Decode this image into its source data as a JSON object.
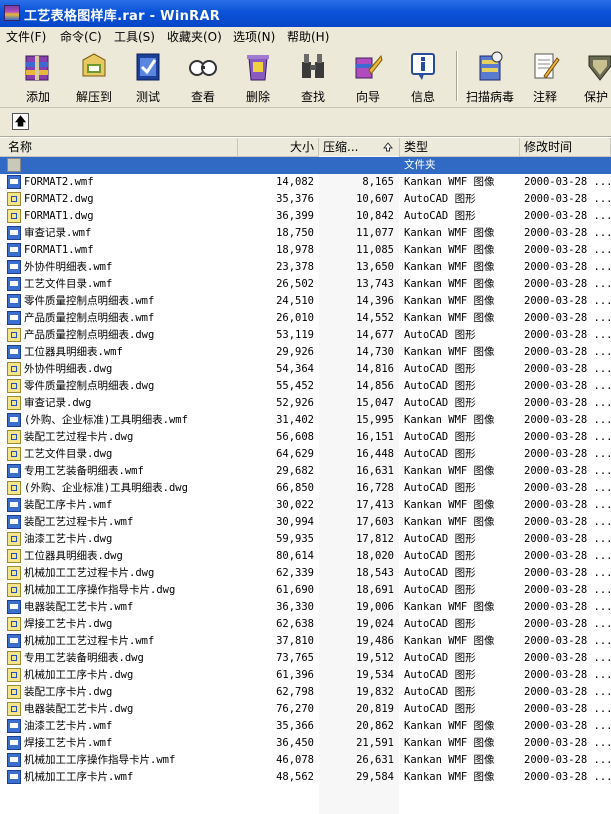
{
  "window": {
    "title": "工艺表格图样库.rar - WinRAR"
  },
  "menu": [
    "文件(F)",
    "命令(C)",
    "工具(S)",
    "收藏夹(O)",
    "选项(N)",
    "帮助(H)"
  ],
  "toolbar": [
    {
      "label": "添加",
      "icon": "add-icon"
    },
    {
      "label": "解压到",
      "icon": "extract-icon"
    },
    {
      "label": "测试",
      "icon": "test-icon"
    },
    {
      "label": "查看",
      "icon": "view-icon"
    },
    {
      "label": "删除",
      "icon": "delete-icon"
    },
    {
      "label": "查找",
      "icon": "find-icon"
    },
    {
      "label": "向导",
      "icon": "wizard-icon"
    },
    {
      "label": "信息",
      "icon": "info-icon"
    },
    {
      "label": "扫描病毒",
      "icon": "virus-scan-icon"
    },
    {
      "label": "注释",
      "icon": "comment-icon"
    },
    {
      "label": "保护",
      "icon": "protect-icon"
    }
  ],
  "address": {
    "up_icon": "up-folder-icon",
    "up_glyph": "🡅"
  },
  "columns": {
    "name": "名称",
    "size": "大小",
    "packed": "压缩...",
    "type": "类型",
    "modified": "修改时间"
  },
  "parent_row": {
    "type": "文件夹"
  },
  "files": [
    {
      "name": "FORMAT2.wmf",
      "size": "14,082",
      "packed": "8,165",
      "type": "Kankan WMF 图像",
      "date": "2000-03-28 ...",
      "kind": "wmf"
    },
    {
      "name": "FORMAT2.dwg",
      "size": "35,376",
      "packed": "10,607",
      "type": "AutoCAD 图形",
      "date": "2000-03-28 ...",
      "kind": "dwg"
    },
    {
      "name": "FORMAT1.dwg",
      "size": "36,399",
      "packed": "10,842",
      "type": "AutoCAD 图形",
      "date": "2000-03-28 ...",
      "kind": "dwg"
    },
    {
      "name": "审查记录.wmf",
      "size": "18,750",
      "packed": "11,077",
      "type": "Kankan WMF 图像",
      "date": "2000-03-28 ...",
      "kind": "wmf"
    },
    {
      "name": "FORMAT1.wmf",
      "size": "18,978",
      "packed": "11,085",
      "type": "Kankan WMF 图像",
      "date": "2000-03-28 ...",
      "kind": "wmf"
    },
    {
      "name": "外协件明细表.wmf",
      "size": "23,378",
      "packed": "13,650",
      "type": "Kankan WMF 图像",
      "date": "2000-03-28 ...",
      "kind": "wmf"
    },
    {
      "name": "工艺文件目录.wmf",
      "size": "26,502",
      "packed": "13,743",
      "type": "Kankan WMF 图像",
      "date": "2000-03-28 ...",
      "kind": "wmf"
    },
    {
      "name": "零件质量控制点明细表.wmf",
      "size": "24,510",
      "packed": "14,396",
      "type": "Kankan WMF 图像",
      "date": "2000-03-28 ...",
      "kind": "wmf"
    },
    {
      "name": "产品质量控制点明细表.wmf",
      "size": "26,010",
      "packed": "14,552",
      "type": "Kankan WMF 图像",
      "date": "2000-03-28 ...",
      "kind": "wmf"
    },
    {
      "name": "产品质量控制点明细表.dwg",
      "size": "53,119",
      "packed": "14,677",
      "type": "AutoCAD 图形",
      "date": "2000-03-28 ...",
      "kind": "dwg"
    },
    {
      "name": "工位器具明细表.wmf",
      "size": "29,926",
      "packed": "14,730",
      "type": "Kankan WMF 图像",
      "date": "2000-03-28 ...",
      "kind": "wmf"
    },
    {
      "name": "外协件明细表.dwg",
      "size": "54,364",
      "packed": "14,816",
      "type": "AutoCAD 图形",
      "date": "2000-03-28 ...",
      "kind": "dwg"
    },
    {
      "name": "零件质量控制点明细表.dwg",
      "size": "55,452",
      "packed": "14,856",
      "type": "AutoCAD 图形",
      "date": "2000-03-28 ...",
      "kind": "dwg"
    },
    {
      "name": "审查记录.dwg",
      "size": "52,926",
      "packed": "15,047",
      "type": "AutoCAD 图形",
      "date": "2000-03-28 ...",
      "kind": "dwg"
    },
    {
      "name": "(外购、企业标准)工具明细表.wmf",
      "size": "31,402",
      "packed": "15,995",
      "type": "Kankan WMF 图像",
      "date": "2000-03-28 ...",
      "kind": "wmf"
    },
    {
      "name": "装配工艺过程卡片.dwg",
      "size": "56,608",
      "packed": "16,151",
      "type": "AutoCAD 图形",
      "date": "2000-03-28 ...",
      "kind": "dwg"
    },
    {
      "name": "工艺文件目录.dwg",
      "size": "64,629",
      "packed": "16,448",
      "type": "AutoCAD 图形",
      "date": "2000-03-28 ...",
      "kind": "dwg"
    },
    {
      "name": "专用工艺装备明细表.wmf",
      "size": "29,682",
      "packed": "16,631",
      "type": "Kankan WMF 图像",
      "date": "2000-03-28 ...",
      "kind": "wmf"
    },
    {
      "name": "(外购、企业标准)工具明细表.dwg",
      "size": "66,850",
      "packed": "16,728",
      "type": "AutoCAD 图形",
      "date": "2000-03-28 ...",
      "kind": "dwg"
    },
    {
      "name": "装配工序卡片.wmf",
      "size": "30,022",
      "packed": "17,413",
      "type": "Kankan WMF 图像",
      "date": "2000-03-28 ...",
      "kind": "wmf"
    },
    {
      "name": "装配工艺过程卡片.wmf",
      "size": "30,994",
      "packed": "17,603",
      "type": "Kankan WMF 图像",
      "date": "2000-03-28 ...",
      "kind": "wmf"
    },
    {
      "name": "油漆工艺卡片.dwg",
      "size": "59,935",
      "packed": "17,812",
      "type": "AutoCAD 图形",
      "date": "2000-03-28 ...",
      "kind": "dwg"
    },
    {
      "name": "工位器具明细表.dwg",
      "size": "80,614",
      "packed": "18,020",
      "type": "AutoCAD 图形",
      "date": "2000-03-28 ...",
      "kind": "dwg"
    },
    {
      "name": "机械加工工艺过程卡片.dwg",
      "size": "62,339",
      "packed": "18,543",
      "type": "AutoCAD 图形",
      "date": "2000-03-28 ...",
      "kind": "dwg"
    },
    {
      "name": "机械加工工序操作指导卡片.dwg",
      "size": "61,690",
      "packed": "18,691",
      "type": "AutoCAD 图形",
      "date": "2000-03-28 ...",
      "kind": "dwg"
    },
    {
      "name": "电器装配工艺卡片.wmf",
      "size": "36,330",
      "packed": "19,006",
      "type": "Kankan WMF 图像",
      "date": "2000-03-28 ...",
      "kind": "wmf"
    },
    {
      "name": "焊接工艺卡片.dwg",
      "size": "62,638",
      "packed": "19,024",
      "type": "AutoCAD 图形",
      "date": "2000-03-28 ...",
      "kind": "dwg"
    },
    {
      "name": "机械加工工艺过程卡片.wmf",
      "size": "37,810",
      "packed": "19,486",
      "type": "Kankan WMF 图像",
      "date": "2000-03-28 ...",
      "kind": "wmf"
    },
    {
      "name": "专用工艺装备明细表.dwg",
      "size": "73,765",
      "packed": "19,512",
      "type": "AutoCAD 图形",
      "date": "2000-03-28 ...",
      "kind": "dwg"
    },
    {
      "name": "机械加工工序卡片.dwg",
      "size": "61,396",
      "packed": "19,534",
      "type": "AutoCAD 图形",
      "date": "2000-03-28 ...",
      "kind": "dwg"
    },
    {
      "name": "装配工序卡片.dwg",
      "size": "62,798",
      "packed": "19,832",
      "type": "AutoCAD 图形",
      "date": "2000-03-28 ...",
      "kind": "dwg"
    },
    {
      "name": "电器装配工艺卡片.dwg",
      "size": "76,270",
      "packed": "20,819",
      "type": "AutoCAD 图形",
      "date": "2000-03-28 ...",
      "kind": "dwg"
    },
    {
      "name": "油漆工艺卡片.wmf",
      "size": "35,366",
      "packed": "20,862",
      "type": "Kankan WMF 图像",
      "date": "2000-03-28 ...",
      "kind": "wmf"
    },
    {
      "name": "焊接工艺卡片.wmf",
      "size": "36,450",
      "packed": "21,591",
      "type": "Kankan WMF 图像",
      "date": "2000-03-28 ...",
      "kind": "wmf"
    },
    {
      "name": "机械加工工序操作指导卡片.wmf",
      "size": "46,078",
      "packed": "26,631",
      "type": "Kankan WMF 图像",
      "date": "2000-03-28 ...",
      "kind": "wmf"
    },
    {
      "name": "机械加工工序卡片.wmf",
      "size": "48,562",
      "packed": "29,584",
      "type": "Kankan WMF 图像",
      "date": "2000-03-28 ...",
      "kind": "wmf"
    }
  ]
}
